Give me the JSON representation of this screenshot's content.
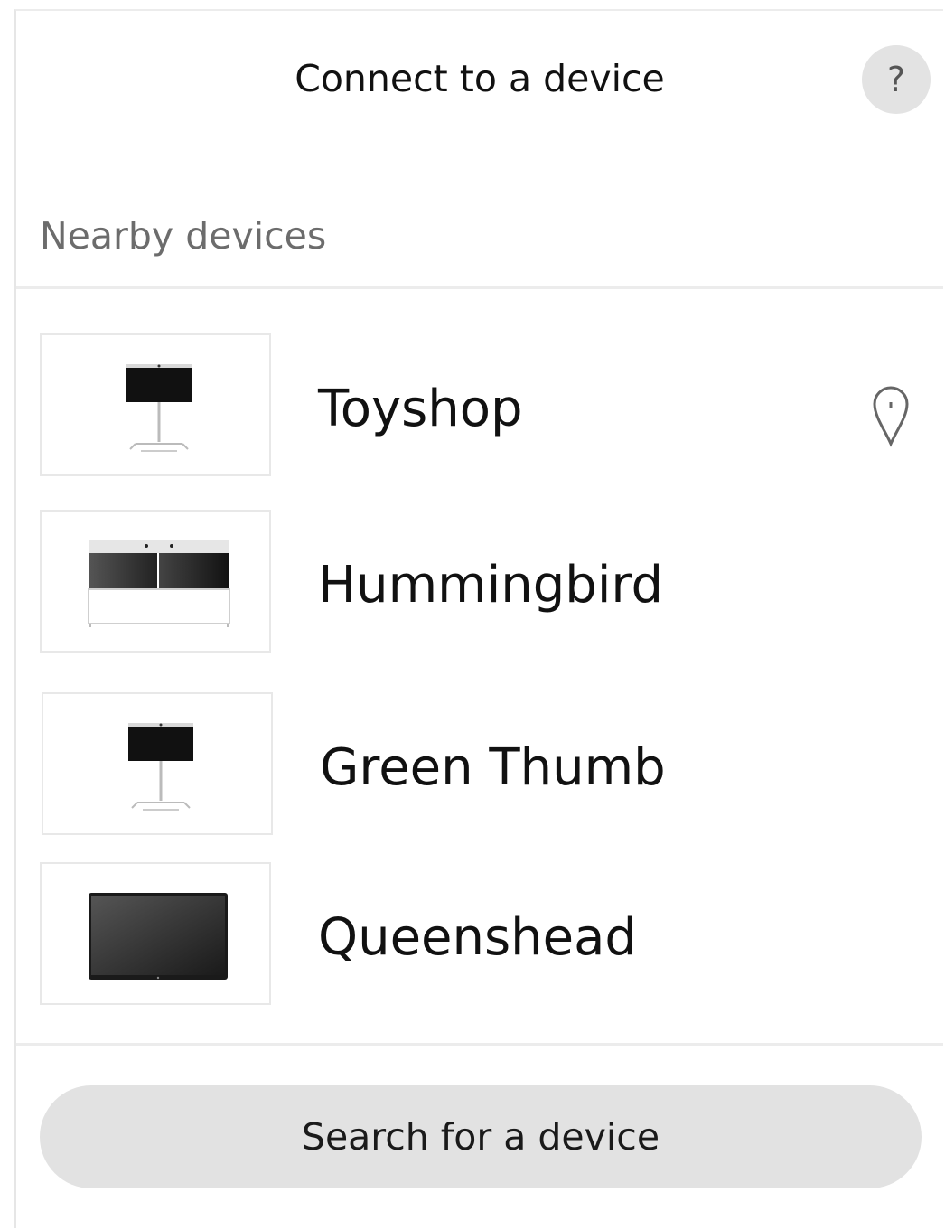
{
  "header": {
    "title": "Connect to a device",
    "help_label": "?"
  },
  "nearby": {
    "label": "Nearby devices",
    "devices": [
      {
        "name": "Toyshop",
        "type": "stand-display-icon",
        "has_location_pin": true
      },
      {
        "name": "Hummingbird",
        "type": "dual-display-cart-icon",
        "has_location_pin": false
      },
      {
        "name": "Green Thumb",
        "type": "stand-display-icon",
        "has_location_pin": false
      },
      {
        "name": "Queenshead",
        "type": "wall-display-icon",
        "has_location_pin": false
      }
    ]
  },
  "footer": {
    "search_label": "Search for a device"
  }
}
